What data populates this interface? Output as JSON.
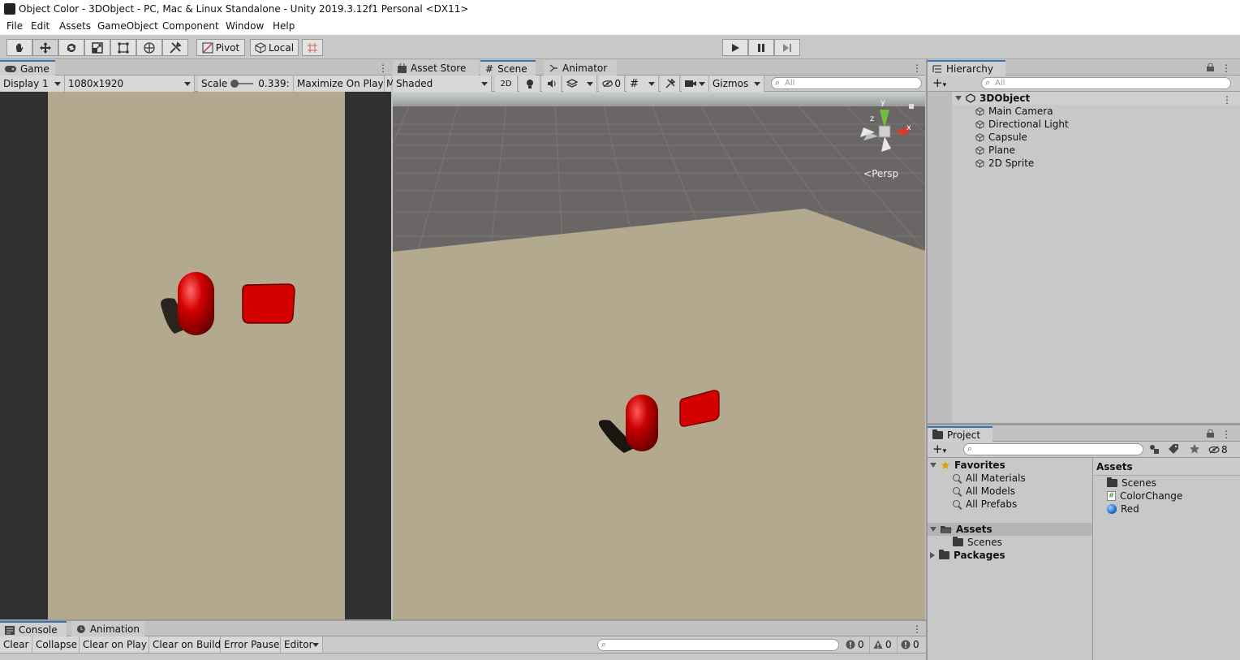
{
  "window": {
    "title": "Object Color - 3DObject - PC, Mac & Linux Standalone - Unity 2019.3.12f1 Personal <DX11>"
  },
  "menu": [
    "File",
    "Edit",
    "Assets",
    "GameObject",
    "Component",
    "Window",
    "Help"
  ],
  "toolbar": {
    "pivot_label": "Pivot",
    "local_label": "Local"
  },
  "game": {
    "tab_label": "Game",
    "display": "Display 1",
    "resolution": "1080x1920",
    "scale_label": "Scale",
    "scale_value": "0.339:",
    "maximize_label": "Maximize On Play",
    "overflow_label": "M"
  },
  "scene": {
    "tabs": [
      "Asset Store",
      "Scene",
      "Animator"
    ],
    "shading": "Shaded",
    "mode_2d": "2D",
    "hidden_count": "0",
    "gizmos_label": "Gizmos",
    "search_placeholder": "All",
    "gizmo": {
      "y": "y",
      "x": "x",
      "z": "z",
      "persp": "Persp"
    }
  },
  "hierarchy": {
    "tab_label": "Hierarchy",
    "search_placeholder": "All",
    "scene_name": "3DObject",
    "items": [
      "Main Camera",
      "Directional Light",
      "Capsule",
      "Plane",
      "2D Sprite"
    ]
  },
  "project": {
    "tab_label": "Project",
    "hidden_count": "8",
    "favorites_label": "Favorites",
    "favorites": [
      "All Materials",
      "All Models",
      "All Prefabs"
    ],
    "assets_label": "Assets",
    "assets_children": [
      "Scenes"
    ],
    "packages_label": "Packages",
    "right_header": "Assets",
    "right_items": [
      {
        "name": "Scenes",
        "icon": "folder-icon"
      },
      {
        "name": "ColorChange",
        "icon": "script-icon"
      },
      {
        "name": "Red",
        "icon": "material-icon"
      }
    ]
  },
  "console": {
    "tabs": [
      "Console",
      "Animation"
    ],
    "buttons": [
      "Clear",
      "Collapse",
      "Clear on Play",
      "Clear on Build",
      "Error Pause",
      "Editor"
    ],
    "counts": {
      "info": "0",
      "warn": "0",
      "error": "0"
    }
  },
  "colors": {
    "accent": "#3a72b0",
    "red_object": "#c00000",
    "plane": "#b3a98f",
    "grid_bg": "#6e6a68"
  }
}
